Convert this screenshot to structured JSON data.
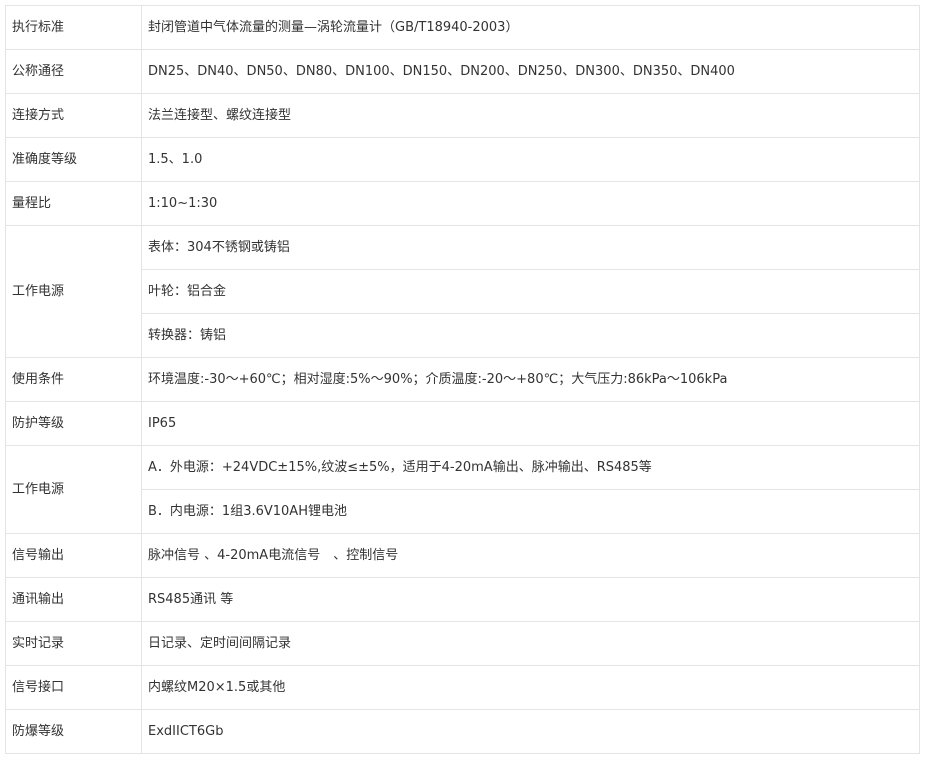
{
  "rows": [
    {
      "label": "执行标准",
      "values": [
        "封闭管道中气体流量的测量—涡轮流量计（GB/T18940-2003）"
      ]
    },
    {
      "label": "公称通径",
      "values": [
        "DN25、DN40、DN50、DN80、DN100、DN150、DN200、DN250、DN300、DN350、DN400"
      ]
    },
    {
      "label": "连接方式",
      "values": [
        "法兰连接型、螺纹连接型"
      ]
    },
    {
      "label": "准确度等级",
      "values": [
        "1.5、1.0"
      ]
    },
    {
      "label": "量程比",
      "values": [
        "1:10~1:30"
      ]
    },
    {
      "label": "工作电源",
      "values": [
        "表体：304不锈钢或铸铝",
        "叶轮：铝合金",
        "转换器：铸铝"
      ]
    },
    {
      "label": "使用条件",
      "values": [
        "环境温度:-30～+60℃；相对湿度:5%～90%；介质温度:-20～+80℃；大气压力:86kPa～106kPa"
      ]
    },
    {
      "label": "防护等级",
      "values": [
        "IP65"
      ]
    },
    {
      "label": "工作电源",
      "values": [
        "A．外电源：+24VDC±15%,纹波≤±5%，适用于4-20mA输出、脉冲输出、RS485等",
        "B．内电源：1组3.6V10AH锂电池"
      ]
    },
    {
      "label": "信号输出",
      "values": [
        "脉冲信号 、4-20mA电流信号　、控制信号"
      ]
    },
    {
      "label": "通讯输出",
      "values": [
        "RS485通讯 等"
      ]
    },
    {
      "label": "实时记录",
      "values": [
        "日记录、定时间间隔记录"
      ]
    },
    {
      "label": "信号接口",
      "values": [
        "内螺纹M20×1.5或其他"
      ]
    },
    {
      "label": "防爆等级",
      "values": [
        "ExdIICT6Gb"
      ]
    }
  ]
}
